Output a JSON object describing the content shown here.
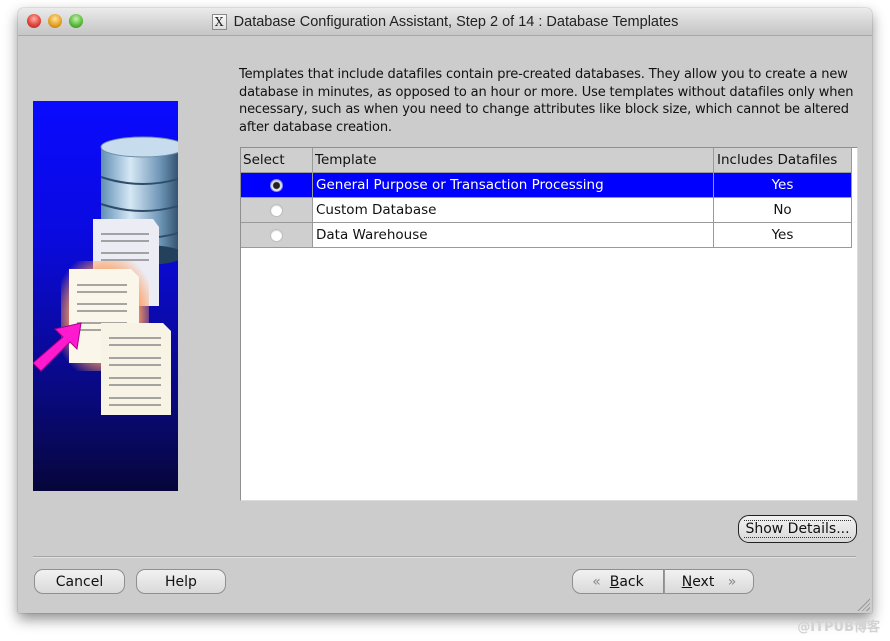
{
  "window": {
    "title": "Database Configuration Assistant, Step 2 of 14 : Database Templates",
    "controls": [
      "close",
      "minimize",
      "zoom"
    ]
  },
  "intro_text": "Templates that include datafiles contain pre-created databases. They allow you to create a new database in minutes, as opposed to an hour or more. Use templates without datafiles only when necessary, such as when you need to change attributes like block size, which cannot be altered after database creation.",
  "table": {
    "columns": [
      "Select",
      "Template",
      "Includes Datafiles"
    ],
    "rows": [
      {
        "selected": true,
        "template": "General Purpose or Transaction Processing",
        "includes_datafiles": "Yes"
      },
      {
        "selected": false,
        "template": "Custom Database",
        "includes_datafiles": "No"
      },
      {
        "selected": false,
        "template": "Data Warehouse",
        "includes_datafiles": "Yes"
      }
    ]
  },
  "buttons": {
    "show_details": "Show Details...",
    "cancel": "Cancel",
    "help": "Help",
    "back_mnemonic": "B",
    "back_rest": "ack",
    "next_mnemonic": "N",
    "next_rest": "ext",
    "back_chevron": "«",
    "next_chevron": "»"
  },
  "colors": {
    "selection": "#0000ff",
    "panel_bg": "#cccccc"
  },
  "watermark": "@ITPUB博客"
}
